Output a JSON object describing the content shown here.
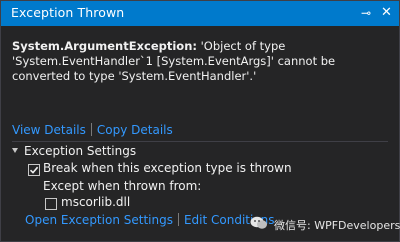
{
  "window": {
    "title": "Exception Thrown",
    "pin_glyph": "⊸",
    "close_glyph": "✕"
  },
  "exception": {
    "type_label": "System.ArgumentException:",
    "message": "'Object of type 'System.EventHandler`1 [System.EventArgs]' cannot be converted to type 'System.EventHandler'.'"
  },
  "links": {
    "view_details": "View Details",
    "copy_details": "Copy Details"
  },
  "settings": {
    "header": "Exception Settings",
    "break_when_thrown": {
      "label": "Break when this exception type is thrown",
      "checked": true
    },
    "except_when_from": "Except when thrown from:",
    "modules": [
      {
        "label": "mscorlib.dll",
        "checked": false
      }
    ]
  },
  "footer_links": {
    "open_settings": "Open Exception Settings",
    "edit_conditions": "Edit Conditions"
  },
  "watermark": {
    "text": "微信号: WPFDevelopers"
  },
  "colors": {
    "title_bar": "#007acc",
    "background": "#252526",
    "link": "#3399ff",
    "text": "#f1f1f1"
  }
}
